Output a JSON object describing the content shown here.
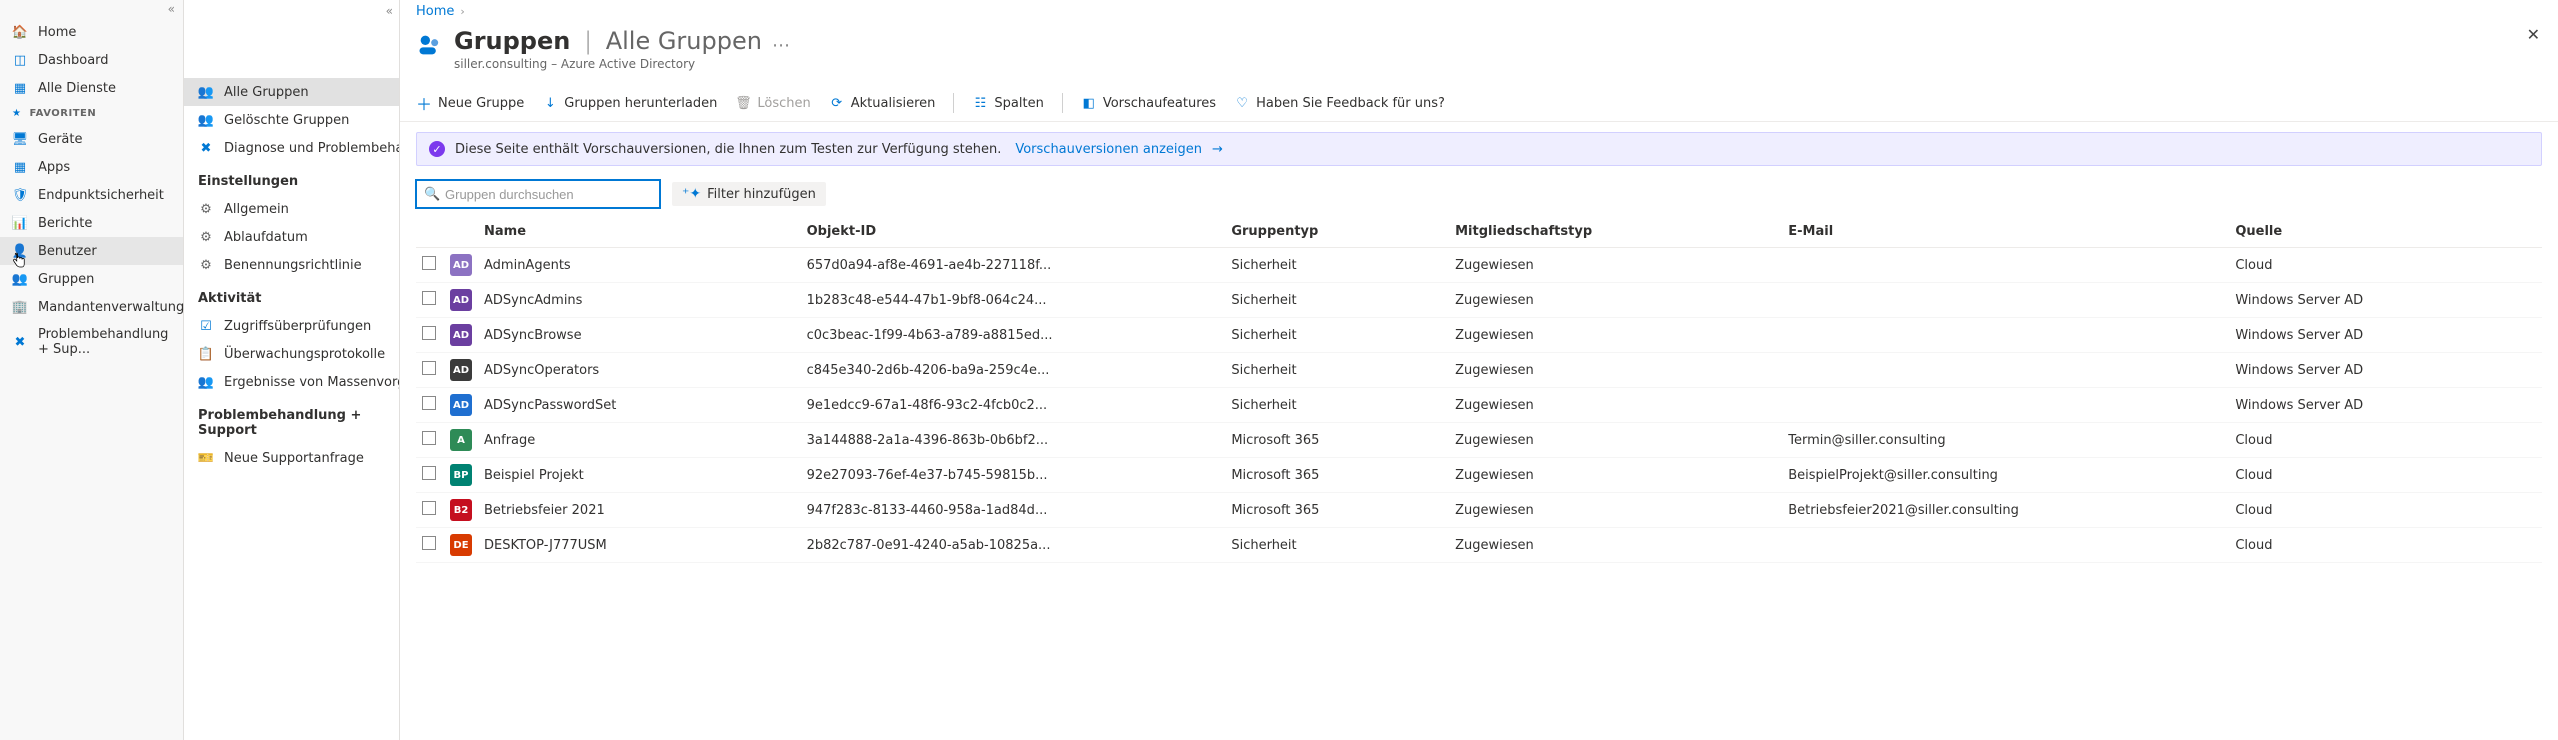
{
  "breadcrumb": {
    "home": "Home"
  },
  "header": {
    "main": "Gruppen",
    "divider": " | ",
    "sub": "Alle Gruppen",
    "subtitle": "siller.consulting – Azure Active Directory"
  },
  "primary_nav": {
    "items": [
      {
        "icon": "home-icon",
        "color": "#0078d4",
        "label": "Home"
      },
      {
        "icon": "dashboard-icon",
        "color": "#0078d4",
        "label": "Dashboard"
      },
      {
        "icon": "services-icon",
        "color": "#0078d4",
        "label": "Alle Dienste"
      }
    ],
    "fav_heading": "FAVORITEN",
    "fav_items": [
      {
        "icon": "devices-icon",
        "color": "#0078d4",
        "label": "Geräte"
      },
      {
        "icon": "apps-icon",
        "color": "#0078d4",
        "label": "Apps"
      },
      {
        "icon": "endpoint-icon",
        "color": "#0078d4",
        "label": "Endpunktsicherheit"
      },
      {
        "icon": "reports-icon",
        "color": "#0078d4",
        "label": "Berichte"
      },
      {
        "icon": "users-icon",
        "color": "#0078d4",
        "label": "Benutzer",
        "selected": true
      },
      {
        "icon": "groups-icon",
        "color": "#0078d4",
        "label": "Gruppen"
      },
      {
        "icon": "tenant-icon",
        "color": "#0078d4",
        "label": "Mandantenverwaltung"
      },
      {
        "icon": "troubleshoot-icon",
        "color": "#0078d4",
        "label": "Problembehandlung + Sup..."
      }
    ]
  },
  "secondary_nav": {
    "top_items": [
      {
        "icon": "groups-icon",
        "color": "#0078d4",
        "label": "Alle Gruppen",
        "active": true
      },
      {
        "icon": "deleted-groups-icon",
        "color": "#0078d4",
        "label": "Gelöschte Gruppen"
      },
      {
        "icon": "diagnose-icon",
        "color": "#0078d4",
        "label": "Diagnose und Problembehandlu..."
      }
    ],
    "settings_heading": "Einstellungen",
    "settings_items": [
      {
        "icon": "gear-icon",
        "color": "#666",
        "label": "Allgemein"
      },
      {
        "icon": "gear-icon",
        "color": "#666",
        "label": "Ablaufdatum"
      },
      {
        "icon": "gear-icon",
        "color": "#666",
        "label": "Benennungsrichtlinie"
      }
    ],
    "activity_heading": "Aktivität",
    "activity_items": [
      {
        "icon": "access-review-icon",
        "color": "#0078d4",
        "label": "Zugriffsüberprüfungen"
      },
      {
        "icon": "audit-icon",
        "color": "#0078d4",
        "label": "Überwachungsprotokolle"
      },
      {
        "icon": "bulk-icon",
        "color": "#5fa33b",
        "label": "Ergebnisse von Massenvorgängen"
      }
    ],
    "support_heading": "Problembehandlung + Support",
    "support_items": [
      {
        "icon": "support-icon",
        "color": "#0078d4",
        "label": "Neue Supportanfrage"
      }
    ]
  },
  "toolbar": {
    "new_group": "Neue Gruppe",
    "download": "Gruppen herunterladen",
    "delete": "Löschen",
    "refresh": "Aktualisieren",
    "columns": "Spalten",
    "preview": "Vorschaufeatures",
    "feedback": "Haben Sie Feedback für uns?"
  },
  "banner": {
    "text": "Diese Seite enthält Vorschauversionen, die Ihnen zum Testen zur Verfügung stehen.",
    "link": "Vorschauversionen anzeigen"
  },
  "search": {
    "placeholder": "Gruppen durchsuchen"
  },
  "filter_chip": "Filter hinzufügen",
  "table": {
    "headers": {
      "name": "Name",
      "objectid": "Objekt-ID",
      "grouptype": "Gruppentyp",
      "membership": "Mitgliedschaftstyp",
      "email": "E-Mail",
      "source": "Quelle"
    },
    "rows": [
      {
        "badge": "AD",
        "color": "#8c72c2",
        "name": "AdminAgents",
        "oid": "657d0a94-af8e-4691-ae4b-227118f...",
        "gtype": "Sicherheit",
        "mtype": "Zugewiesen",
        "email": "",
        "source": "Cloud"
      },
      {
        "badge": "AD",
        "color": "#6b3fa0",
        "name": "ADSyncAdmins",
        "oid": "1b283c48-e544-47b1-9bf8-064c24...",
        "gtype": "Sicherheit",
        "mtype": "Zugewiesen",
        "email": "",
        "source": "Windows Server AD"
      },
      {
        "badge": "AD",
        "color": "#6b3fa0",
        "name": "ADSyncBrowse",
        "oid": "c0c3beac-1f99-4b63-a789-a8815ed...",
        "gtype": "Sicherheit",
        "mtype": "Zugewiesen",
        "email": "",
        "source": "Windows Server AD"
      },
      {
        "badge": "AD",
        "color": "#3b3b3b",
        "name": "ADSyncOperators",
        "oid": "c845e340-2d6b-4206-ba9a-259c4e...",
        "gtype": "Sicherheit",
        "mtype": "Zugewiesen",
        "email": "",
        "source": "Windows Server AD"
      },
      {
        "badge": "AD",
        "color": "#1f6fd0",
        "name": "ADSyncPasswordSet",
        "oid": "9e1edcc9-67a1-48f6-93c2-4fcb0c2...",
        "gtype": "Sicherheit",
        "mtype": "Zugewiesen",
        "email": "",
        "source": "Windows Server AD"
      },
      {
        "badge": "A",
        "color": "#2e8b57",
        "name": "Anfrage",
        "oid": "3a144888-2a1a-4396-863b-0b6bf2...",
        "gtype": "Microsoft 365",
        "mtype": "Zugewiesen",
        "email": "Termin@siller.consulting",
        "source": "Cloud"
      },
      {
        "badge": "BP",
        "color": "#008272",
        "name": "Beispiel Projekt",
        "oid": "92e27093-76ef-4e37-b745-59815b...",
        "gtype": "Microsoft 365",
        "mtype": "Zugewiesen",
        "email": "BeispielProjekt@siller.consulting",
        "source": "Cloud"
      },
      {
        "badge": "B2",
        "color": "#c50f1f",
        "name": "Betriebsfeier 2021",
        "oid": "947f283c-8133-4460-958a-1ad84d...",
        "gtype": "Microsoft 365",
        "mtype": "Zugewiesen",
        "email": "Betriebsfeier2021@siller.consulting",
        "source": "Cloud"
      },
      {
        "badge": "DE",
        "color": "#d83b01",
        "name": "DESKTOP-J777USM",
        "oid": "2b82c787-0e91-4240-a5ab-10825a...",
        "gtype": "Sicherheit",
        "mtype": "Zugewiesen",
        "email": "",
        "source": "Cloud"
      }
    ]
  }
}
